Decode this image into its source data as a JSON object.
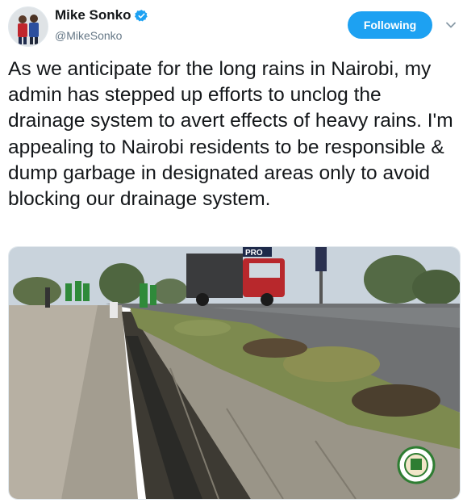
{
  "user": {
    "display_name": "Mike Sonko",
    "handle": "@MikeSonko",
    "verified_icon": "verified-badge-icon"
  },
  "follow_button": {
    "label": "Following"
  },
  "menu": {
    "icon": "chevron-down-icon"
  },
  "tweet": {
    "text": "As we anticipate for the long rains in Nairobi, my admin has stepped up efforts to unclog the drainage system to avert effects of heavy rains. I'm appealing to Nairobi residents to be responsible & dump garbage in designated areas only to avoid blocking our drainage system."
  },
  "media": {
    "truck_sign": "PRO",
    "colors": {
      "sky": "#c9d3dc",
      "grass": "#7d8a4f",
      "concrete": "#9a9588",
      "road": "#6f7173",
      "truck_red": "#b8282c",
      "worker_green": "#2f8a3a"
    }
  },
  "theme": {
    "accent": "#1da1f2",
    "text": "#14171a",
    "muted": "#657786"
  }
}
